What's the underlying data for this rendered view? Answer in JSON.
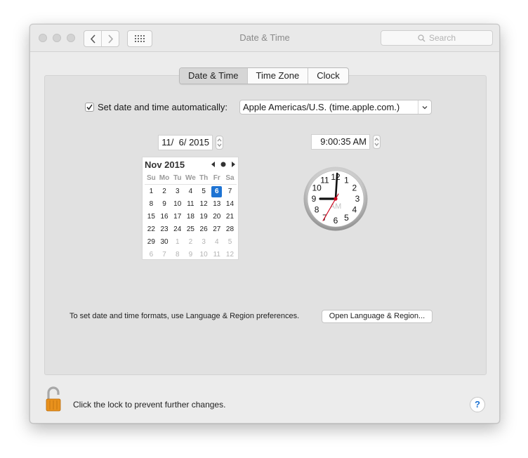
{
  "window": {
    "title": "Date & Time",
    "search_placeholder": "Search"
  },
  "tabs": [
    {
      "label": "Date & Time",
      "active": true
    },
    {
      "label": "Time Zone",
      "active": false
    },
    {
      "label": "Clock",
      "active": false
    }
  ],
  "auto_time": {
    "checked": true,
    "label": "Set date and time automatically:",
    "server": "Apple Americas/U.S. (time.apple.com.)"
  },
  "date_field": "11/  6/ 2015",
  "time_field": "9:00:35 AM",
  "calendar": {
    "month_label": "Nov 2015",
    "weekdays": [
      "Su",
      "Mo",
      "Tu",
      "We",
      "Th",
      "Fr",
      "Sa"
    ],
    "weeks": [
      [
        {
          "d": "1"
        },
        {
          "d": "2"
        },
        {
          "d": "3"
        },
        {
          "d": "4"
        },
        {
          "d": "5"
        },
        {
          "d": "6",
          "sel": true
        },
        {
          "d": "7"
        }
      ],
      [
        {
          "d": "8"
        },
        {
          "d": "9"
        },
        {
          "d": "10"
        },
        {
          "d": "11"
        },
        {
          "d": "12"
        },
        {
          "d": "13"
        },
        {
          "d": "14"
        }
      ],
      [
        {
          "d": "15"
        },
        {
          "d": "16"
        },
        {
          "d": "17"
        },
        {
          "d": "18"
        },
        {
          "d": "19"
        },
        {
          "d": "20"
        },
        {
          "d": "21"
        }
      ],
      [
        {
          "d": "22"
        },
        {
          "d": "23"
        },
        {
          "d": "24"
        },
        {
          "d": "25"
        },
        {
          "d": "26"
        },
        {
          "d": "27"
        },
        {
          "d": "28"
        }
      ],
      [
        {
          "d": "29"
        },
        {
          "d": "30"
        },
        {
          "d": "1",
          "dim": true
        },
        {
          "d": "2",
          "dim": true
        },
        {
          "d": "3",
          "dim": true
        },
        {
          "d": "4",
          "dim": true
        },
        {
          "d": "5",
          "dim": true
        }
      ],
      [
        {
          "d": "6",
          "dim": true
        },
        {
          "d": "7",
          "dim": true
        },
        {
          "d": "8",
          "dim": true
        },
        {
          "d": "9",
          "dim": true
        },
        {
          "d": "10",
          "dim": true
        },
        {
          "d": "11",
          "dim": true
        },
        {
          "d": "12",
          "dim": true
        }
      ]
    ]
  },
  "clock": {
    "numerals": [
      "12",
      "1",
      "2",
      "3",
      "4",
      "5",
      "6",
      "7",
      "8",
      "9",
      "10",
      "11"
    ],
    "am_pm": "AM",
    "hours": 9,
    "minutes": 0,
    "seconds": 35,
    "second_hand_color": "#d0021b"
  },
  "formats": {
    "text": "To set date and time formats, use Language & Region preferences.",
    "button_label": "Open Language & Region..."
  },
  "lock": {
    "text": "Click the lock to prevent further changes.",
    "icon": "unlocked-padlock-icon"
  },
  "help_label": "?",
  "colors": {
    "accent": "#1d73d3",
    "lock_body": "#e8911c"
  }
}
